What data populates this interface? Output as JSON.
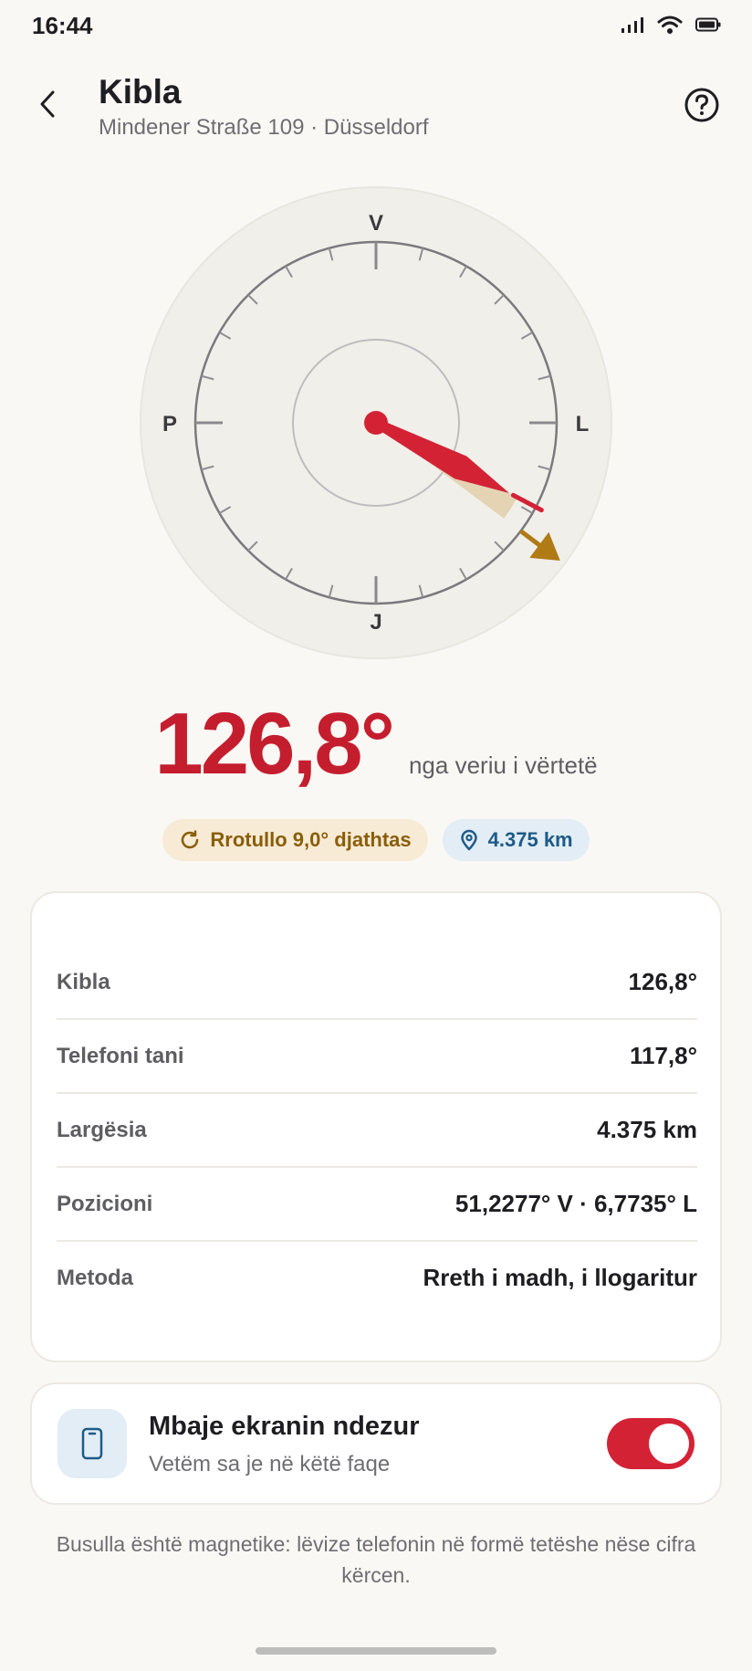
{
  "status_bar": {
    "time": "16:44"
  },
  "header": {
    "title": "Kibla",
    "subtitle": "Mindener Straße 109 · Düsseldorf"
  },
  "compass": {
    "labels": {
      "north": "V",
      "south": "J",
      "east": "L",
      "west": "P"
    },
    "qibla_bearing": 126.8,
    "phone_heading": 117.8
  },
  "reading": {
    "degrees": "126,8°",
    "reference": "nga veriu i vërtetë"
  },
  "pills": {
    "rotate": "Rrotullo 9,0° djathtas",
    "distance": "4.375 km"
  },
  "details": [
    {
      "key": "Kibla",
      "value": "126,8°"
    },
    {
      "key": "Telefoni tani",
      "value": "117,8°"
    },
    {
      "key": "Largësia",
      "value": "4.375 km"
    },
    {
      "key": "Pozicioni",
      "value": "51,2277° V · 6,7735° L"
    },
    {
      "key": "Metoda",
      "value": "Rreth i madh, i llogaritur"
    }
  ],
  "keep_screen": {
    "title": "Mbaje ekranin ndezur",
    "subtitle": "Vetëm sa je në këtë faqe",
    "enabled": true
  },
  "footnote": "Busulla është magnetike: lëvize telefonin në formë tetëshe nëse cifra kërcen.",
  "colors": {
    "accent_red": "#C41E2E",
    "gold": "#B07A14",
    "blue": "#1E5B86",
    "background": "#FAF8F5"
  }
}
